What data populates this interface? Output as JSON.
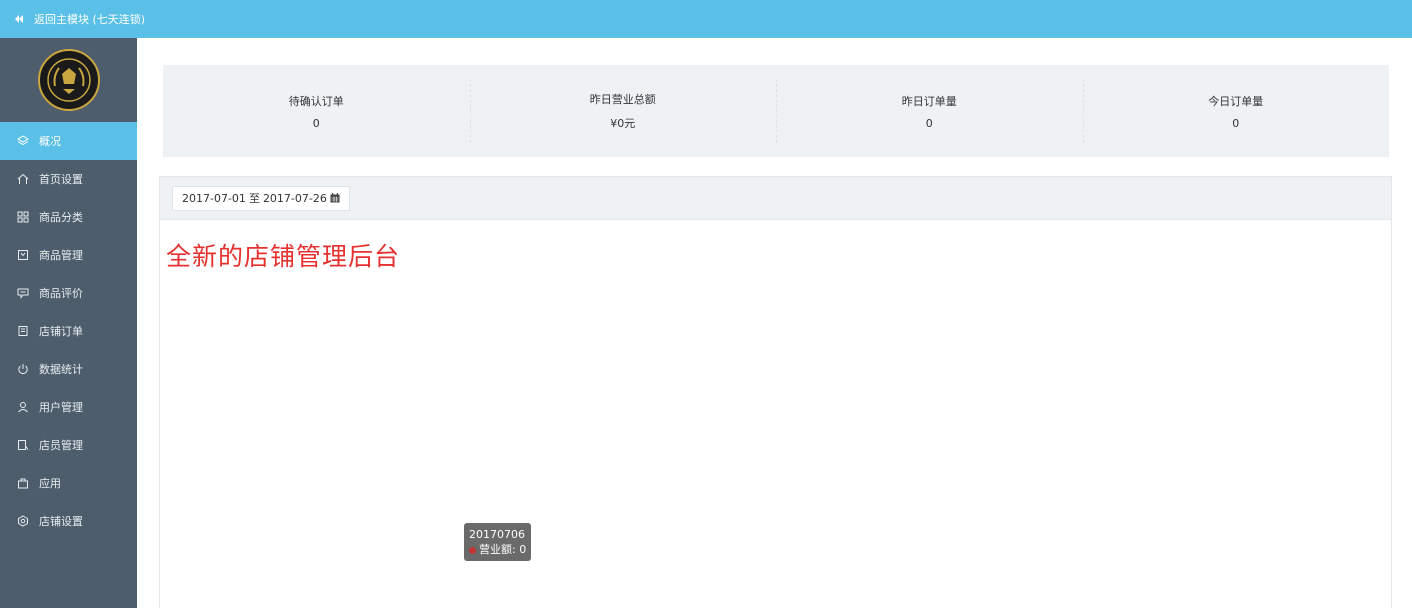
{
  "topbar": {
    "back_label": "返回主模块 (七天连锁)"
  },
  "sidebar": {
    "items": [
      {
        "label": "概况",
        "icon": "layers-icon",
        "active": true
      },
      {
        "label": "首页设置",
        "icon": "home-icon"
      },
      {
        "label": "商品分类",
        "icon": "grid-icon"
      },
      {
        "label": "商品管理",
        "icon": "box-icon"
      },
      {
        "label": "商品评价",
        "icon": "comment-icon"
      },
      {
        "label": "店铺订单",
        "icon": "order-icon"
      },
      {
        "label": "数据统计",
        "icon": "power-icon"
      },
      {
        "label": "用户管理",
        "icon": "user-icon"
      },
      {
        "label": "店员管理",
        "icon": "staff-icon"
      },
      {
        "label": "应用",
        "icon": "bag-icon"
      },
      {
        "label": "店铺设置",
        "icon": "settings-icon"
      }
    ]
  },
  "stats": [
    {
      "label": "待确认订单",
      "value": "0"
    },
    {
      "label": "昨日营业总额",
      "value": "¥0元"
    },
    {
      "label": "昨日订单量",
      "value": "0"
    },
    {
      "label": "今日订单量",
      "value": "0"
    }
  ],
  "date_range": {
    "start": "2017-07-01",
    "sep": "至",
    "end": "2017-07-26"
  },
  "headline": "全新的店铺管理后台",
  "tooltip": {
    "date": "20170706",
    "series": "营业额",
    "value": "0"
  },
  "colors": {
    "accent": "#5bc0e8",
    "sidebar": "#4e5d6c",
    "headline": "#e5312f",
    "series": "#c23531"
  }
}
